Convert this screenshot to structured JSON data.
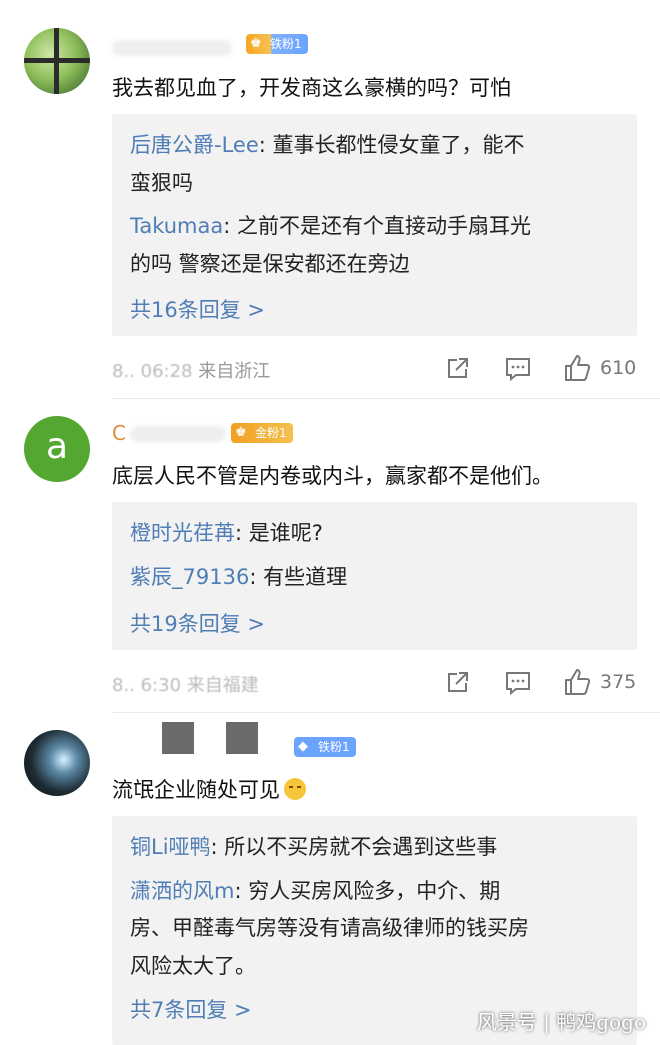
{
  "comments": [
    {
      "badge": "铁粉1",
      "text": "我去都见血了，开发商这么豪横的吗？可怕",
      "replies": [
        {
          "user": "后唐公爵-Lee",
          "text": ": 董事长都性侵女童了，能不",
          "cont": "蛮狠吗"
        },
        {
          "user": "Takumaa",
          "text": ": 之前不是还有个直接动手扇耳光",
          "cont": "的吗  警察还是保安都还在旁边"
        }
      ],
      "more": "共16条回复 >",
      "time": "8.. 06:28",
      "location": "来自浙江",
      "likes": "610"
    },
    {
      "avatar_letter": "a",
      "name_initial": "C",
      "badge": "金粉1",
      "text": "底层人民不管是内卷或内斗，赢家都不是他们。",
      "replies": [
        {
          "user": "橙时光荏苒",
          "text": ": 是谁呢?"
        },
        {
          "user": "紫辰_79136",
          "text": ": 有些道理"
        }
      ],
      "more": "共19条回复 >",
      "time": "8.. 6:30",
      "location": "来自福建",
      "likes": "375"
    },
    {
      "badge": "铁粉1",
      "text": "流氓企业随处可见",
      "replies": [
        {
          "user": "铜Li哑鸭",
          "text": ": 所以不买房就不会遇到这些事"
        },
        {
          "user": "潇洒的风m",
          "text": ": 穷人买房风险多，中介、期",
          "cont": "房、甲醛毒气房等没有请高级律师的钱买房",
          "cont2": "风险太大了。"
        }
      ],
      "more": "共7条回复 >"
    }
  ],
  "watermark": "风景号 | 鸭鸡gogo",
  "colors": {
    "link": "#4f7db5",
    "reply_bg": "#f2f2f2",
    "meta": "#999999"
  },
  "icons": [
    "share-icon",
    "comment-icon",
    "like-icon"
  ]
}
